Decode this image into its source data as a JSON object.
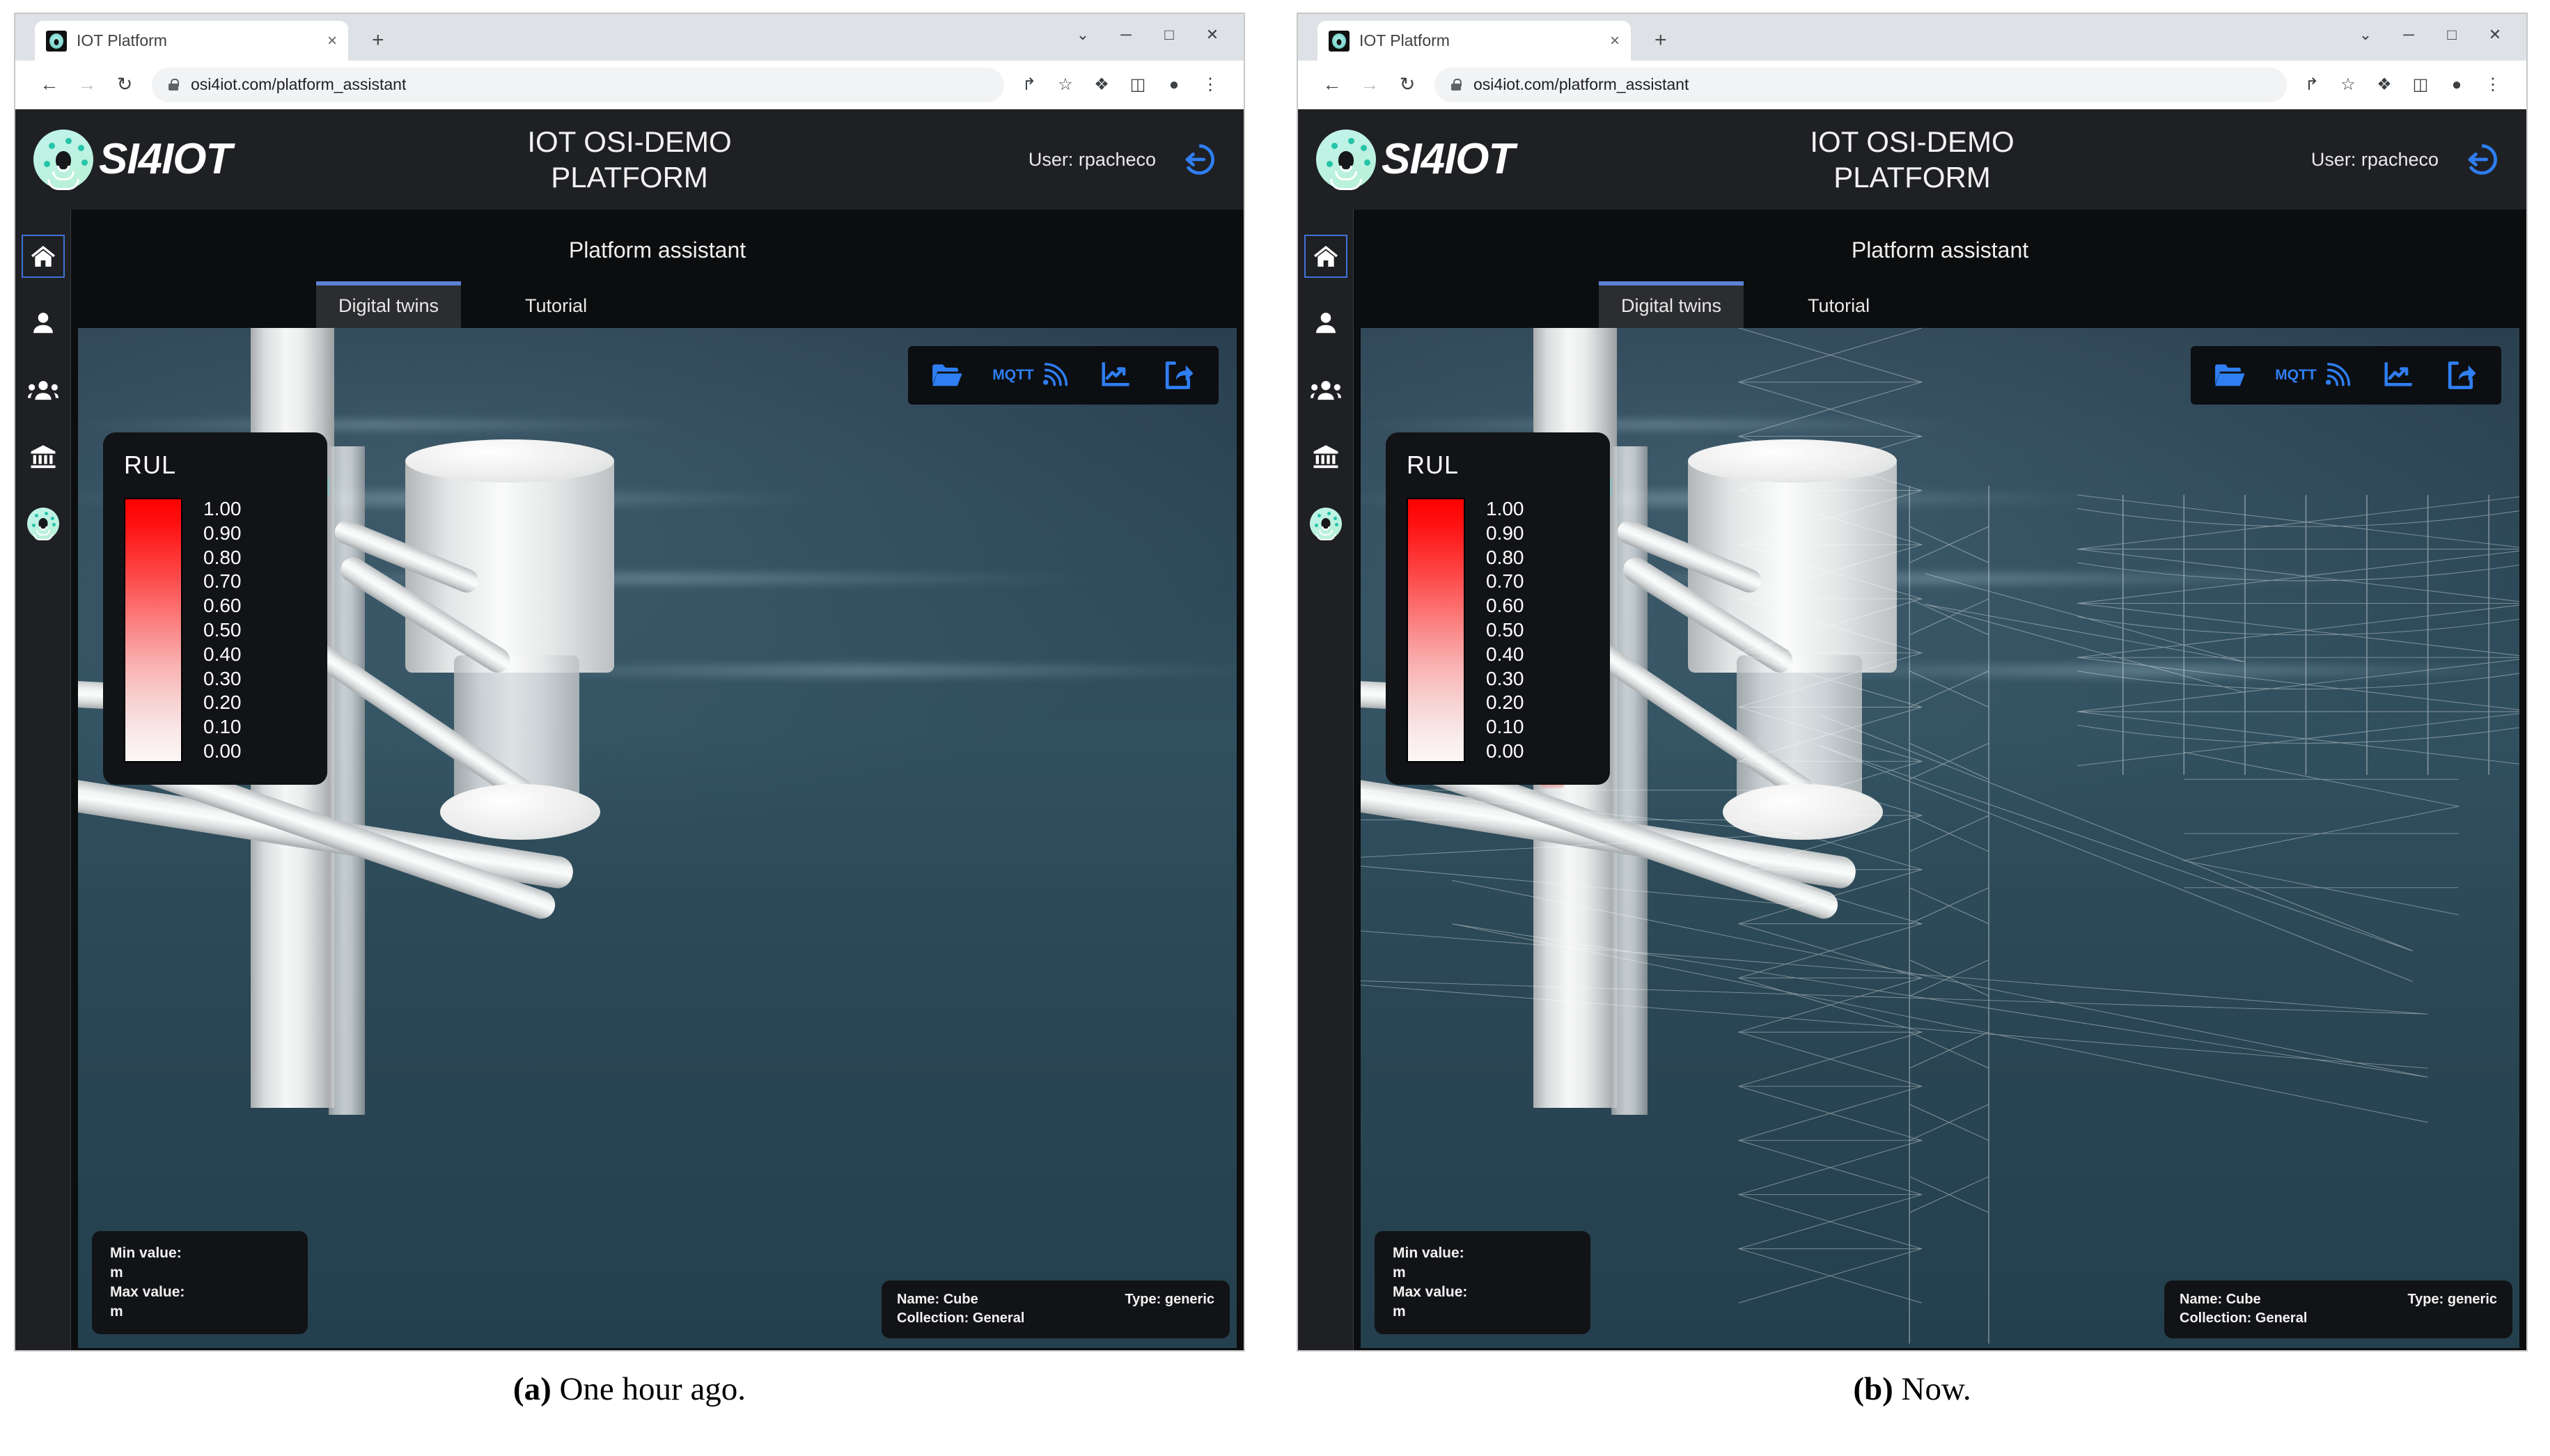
{
  "browser": {
    "tab_title": "IOT Platform",
    "favicon": "si4iot-logo-icon",
    "close_glyph": "×",
    "newtab_glyph": "+",
    "window_controls": [
      {
        "name": "chevron-down-icon",
        "glyph": "⌄"
      },
      {
        "name": "minimize-icon",
        "glyph": "─"
      },
      {
        "name": "maximize-icon",
        "glyph": "□"
      },
      {
        "name": "close-window-icon",
        "glyph": "✕"
      }
    ],
    "nav": {
      "back_glyph": "←",
      "forward_glyph": "→",
      "reload_glyph": "↻"
    },
    "url": "osi4iot.com/platform_assistant",
    "url_placeholder": "Search Google or type a URL",
    "omni_icons": [
      {
        "name": "share-page-icon",
        "glyph": "↱"
      },
      {
        "name": "bookmark-star-icon",
        "glyph": "☆"
      },
      {
        "name": "extensions-puzzle-icon",
        "glyph": "❖"
      },
      {
        "name": "side-panel-icon",
        "glyph": "◫"
      },
      {
        "name": "profile-avatar-icon",
        "glyph": "●"
      },
      {
        "name": "browser-menu-icon",
        "glyph": "⋮"
      }
    ]
  },
  "app": {
    "brand_name": "SI4IOT",
    "title": "IOT OSI-DEMO\nPLATFORM",
    "user_label": "User: rpacheco",
    "logout_icon": "logout-icon",
    "page_title": "Platform assistant",
    "accent_blue": "#3f72d7",
    "toolbar_blue": "#2f7ef2",
    "panel_bg": "#121316",
    "header_bg": "#1f2023"
  },
  "sidebar": {
    "items": [
      {
        "name": "sidebar-item-home",
        "icon": "home-icon",
        "active": true
      },
      {
        "name": "sidebar-item-user",
        "icon": "user-icon",
        "active": false
      },
      {
        "name": "sidebar-item-groups",
        "icon": "users-group-icon",
        "active": false
      },
      {
        "name": "sidebar-item-organizations",
        "icon": "bank-institution-icon",
        "active": false
      },
      {
        "name": "sidebar-item-platform",
        "icon": "si4iot-logo-icon",
        "active": false
      }
    ]
  },
  "tabs": [
    {
      "label": "Digital twins",
      "active": true
    },
    {
      "label": "Tutorial",
      "active": false
    }
  ],
  "toolbar": {
    "items": [
      {
        "name": "open-folder-button",
        "icon": "folder-open-icon",
        "label": ""
      },
      {
        "name": "mqtt-connection-button",
        "icon": "mqtt-signal-icon",
        "label": "MQTT"
      },
      {
        "name": "chart-button",
        "icon": "trending-chart-icon",
        "label": ""
      },
      {
        "name": "export-share-button",
        "icon": "share-export-icon",
        "label": ""
      }
    ]
  },
  "legend": {
    "title": "RUL",
    "ticks": [
      "1.00",
      "0.90",
      "0.80",
      "0.70",
      "0.60",
      "0.50",
      "0.40",
      "0.30",
      "0.20",
      "0.10",
      "0.00"
    ],
    "gradient_top_color": "#fe0000",
    "gradient_bottom_color": "#fdf8f8"
  },
  "minmax": {
    "min_label": "Min value:",
    "min_value": "m",
    "max_label": "Max value:",
    "max_value": "m"
  },
  "object_info": {
    "name": "Name: Cube",
    "type": "Type: generic",
    "collection": "Collection: General"
  },
  "captions": {
    "a_marker": "(a)",
    "a_text": " One hour ago.",
    "b_marker": "(b)",
    "b_text": " Now."
  }
}
